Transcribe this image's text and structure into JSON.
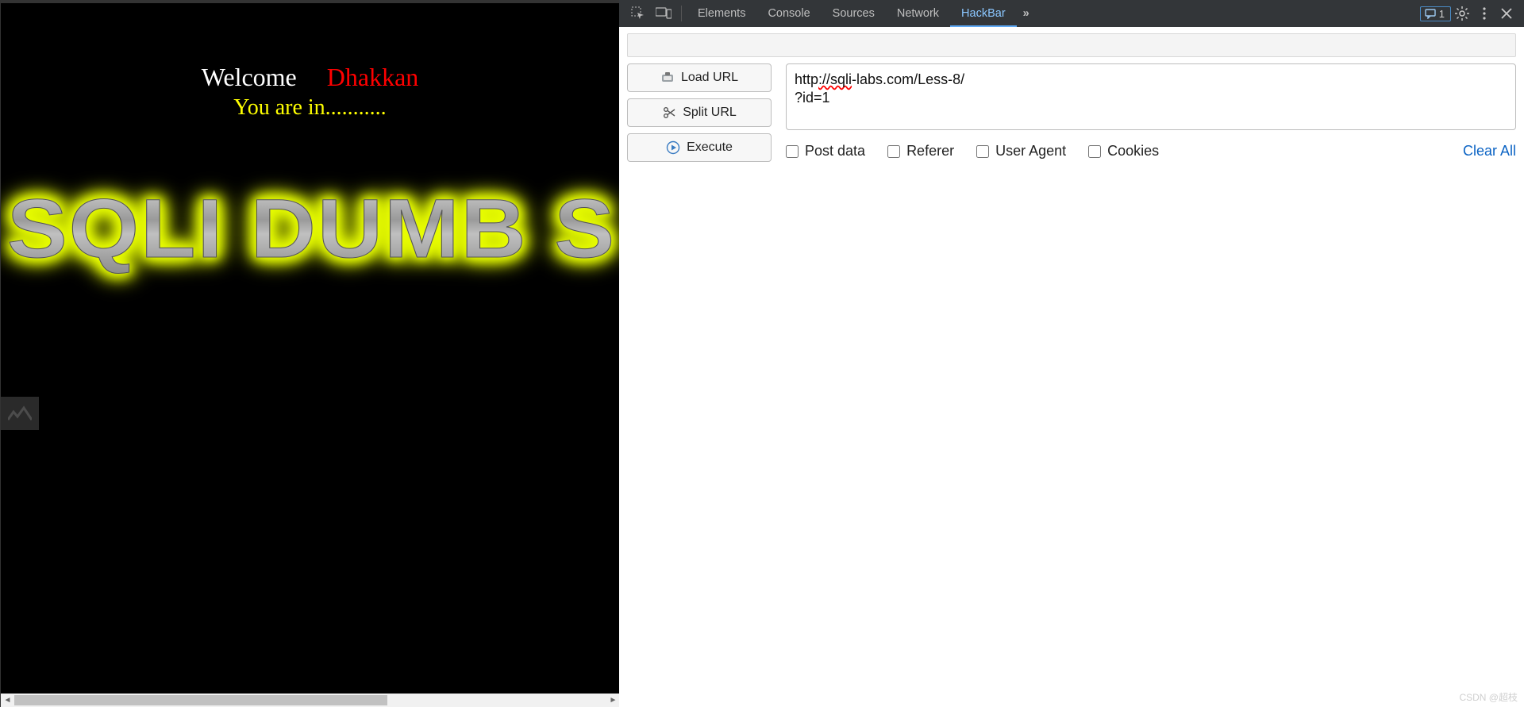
{
  "page": {
    "welcome_label": "Welcome",
    "dhakkan_label": "Dhakkan",
    "status_line": "You are in...........",
    "banner_text": "SQLI DUMB S"
  },
  "devtools": {
    "tabs": [
      "Elements",
      "Console",
      "Sources",
      "Network",
      "HackBar"
    ],
    "active_tab": "HackBar",
    "more_glyph": "»",
    "message_count": "1"
  },
  "hackbar": {
    "buttons": {
      "load_url": "Load URL",
      "split_url": "Split URL",
      "execute": "Execute"
    },
    "url_value_line1": "http://sqli-labs.com/Less-8/",
    "url_value_line2": "?id=1",
    "options": {
      "post_data": "Post data",
      "referer": "Referer",
      "user_agent": "User Agent",
      "cookies": "Cookies"
    },
    "clear_all": "Clear All"
  },
  "watermark": "CSDN @超枝"
}
